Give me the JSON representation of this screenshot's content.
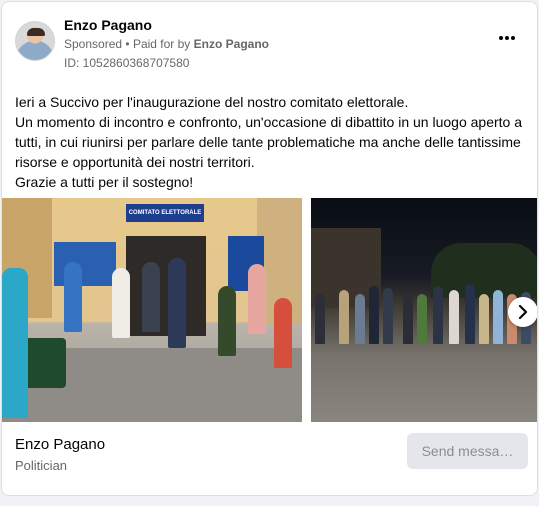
{
  "post": {
    "author": "Enzo Pagano",
    "sponsored": "Sponsored",
    "separator": "•",
    "paid_for_prefix": "Paid for by",
    "paid_for_name": "Enzo Pagano",
    "ad_id": "ID: 1052860368707580",
    "more_icon": "more-horizontal-icon",
    "text_lines": [
      "Ieri a Succivo per l'inaugurazione del nostro comitato elettorale.",
      "Un momento di incontro e confronto, un'occasione di dibattito in un luogo aperto a tutti, in cui riunirsi per parlare delle tante problematiche ma anche delle tantissime risorse e opportunità dei nostri territori.",
      "Grazie a tutti per il sostegno!"
    ]
  },
  "carousel": {
    "photo1_sign": "COMITATO ELETTORALE",
    "next_icon": "chevron-right-icon"
  },
  "footer": {
    "page_name": "Enzo Pagano",
    "category": "Politician",
    "send_button": "Send messa…"
  }
}
